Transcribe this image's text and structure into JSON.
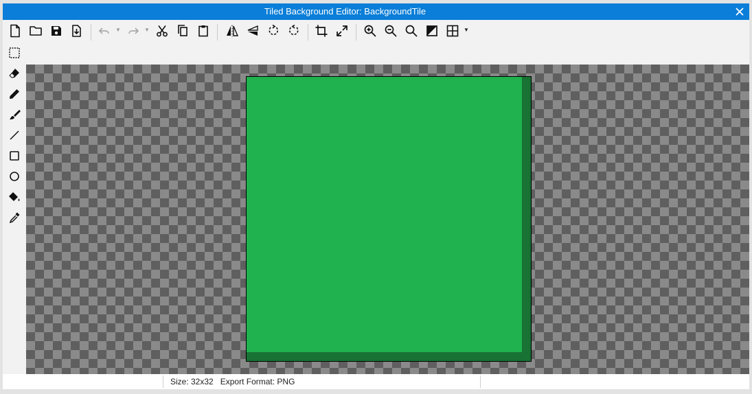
{
  "window": {
    "title": "Tiled Background Editor: BackgroundTile"
  },
  "toolbar": {
    "tools": [
      {
        "icon": "new-file-icon"
      },
      {
        "icon": "open-folder-icon"
      },
      {
        "icon": "save-icon"
      },
      {
        "icon": "export-icon"
      },
      {
        "icon": "undo-icon",
        "enabled": false
      },
      {
        "icon": "redo-icon",
        "enabled": false
      },
      {
        "icon": "cut-icon"
      },
      {
        "icon": "copy-icon"
      },
      {
        "icon": "paste-icon"
      },
      {
        "icon": "flip-horizontal-icon"
      },
      {
        "icon": "flip-vertical-icon"
      },
      {
        "icon": "rotate-counterclockwise-icon"
      },
      {
        "icon": "rotate-clockwise-icon"
      },
      {
        "icon": "crop-icon"
      },
      {
        "icon": "resize-icon"
      },
      {
        "icon": "zoom-in-icon"
      },
      {
        "icon": "zoom-out-icon"
      },
      {
        "icon": "zoom-reset-icon"
      },
      {
        "icon": "transparency-toggle-icon"
      },
      {
        "icon": "grid-icon"
      }
    ]
  },
  "sidebar": {
    "tools": [
      {
        "icon": "selection-icon"
      },
      {
        "icon": "eraser-icon"
      },
      {
        "icon": "pencil-icon"
      },
      {
        "icon": "brush-icon"
      },
      {
        "icon": "line-icon"
      },
      {
        "icon": "rectangle-icon"
      },
      {
        "icon": "ellipse-icon"
      },
      {
        "icon": "fill-bucket-icon"
      },
      {
        "icon": "color-picker-icon"
      }
    ]
  },
  "canvas": {
    "tile_colors": {
      "main": "#1fb24e",
      "shade": "#187233"
    }
  },
  "status": {
    "size": "Size: 32x32",
    "export_format": "Export Format: PNG"
  }
}
